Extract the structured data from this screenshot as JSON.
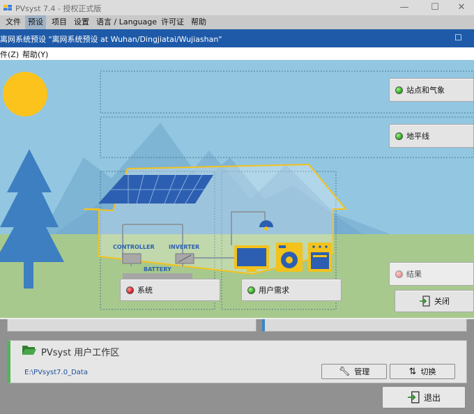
{
  "app": {
    "title": "PVsyst 7.4 - 授权正式版"
  },
  "main_menu": [
    {
      "label": "文件"
    },
    {
      "label": "预设"
    },
    {
      "label": "项目"
    },
    {
      "label": "设置"
    },
    {
      "label": "语言 / Language"
    },
    {
      "label": "许可证"
    },
    {
      "label": "帮助"
    }
  ],
  "window_controls": {
    "minimize": "—",
    "maximize": "☐",
    "close": "✕"
  },
  "dialog": {
    "title": "离网系统预设 \"离网系统预设  at Wuhan/Dingjiatai/Wujiashan\"",
    "maximize": "☐",
    "menu": [
      {
        "label": "件(Z)"
      },
      {
        "label": "帮助(Y)"
      }
    ]
  },
  "scene": {
    "labels": {
      "controller": "CONTROLLER",
      "inverter": "INVERTER",
      "battery": "BATTERY"
    },
    "buttons": {
      "site_meteo": "站点和气象",
      "horizon": "地平线",
      "system": "系统",
      "user_needs": "用户需求",
      "results": "结果",
      "close": "关闭"
    }
  },
  "workspace": {
    "title": "PVsyst 用户工作区",
    "path": "E:\\PVsyst7.0_Data",
    "manage": "管理",
    "switch": "切换",
    "exit": "退出"
  },
  "colors": {
    "dialog_title": "#1e5aa8",
    "sky": "#93c7e1",
    "grass": "#a8c98d",
    "house": "#f3c21c",
    "workspace_accent": "#55b25a"
  }
}
